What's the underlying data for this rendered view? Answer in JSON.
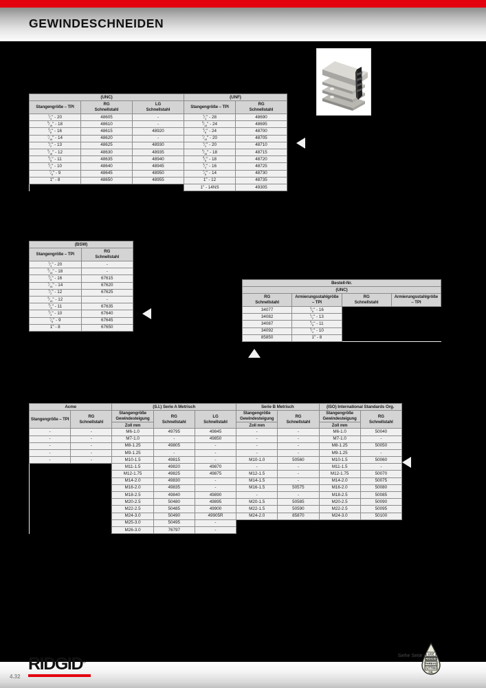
{
  "header": {
    "title": "GEWINDESCHNEIDEN",
    "accent_color": "#e3000f"
  },
  "product_image": {
    "alt": "Gewindeschneidbacken Stapel"
  },
  "tables": {
    "unc_unf": {
      "groups": [
        "(UNC)",
        "(UNF)"
      ],
      "columns": [
        "Stangengröße – TPI",
        "RG\nSchnellstahl",
        "LG\nSchnellstahl",
        "Stangengröße – TPI",
        "RG\nSchnellstahl"
      ],
      "rows": [
        [
          "1/4\" - 20",
          "48605",
          "-",
          "1/4\" - 28",
          "48690"
        ],
        [
          "5/16\" - 18",
          "48610",
          "-",
          "5/16\" - 24",
          "48695"
        ],
        [
          "3/8\" - 16",
          "48615",
          "48920",
          "3/8\" - 24",
          "48700"
        ],
        [
          "7/16\" - 14",
          "48620",
          "-",
          "7/16\" - 20",
          "48705"
        ],
        [
          "1/2\" - 13",
          "48625",
          "48930",
          "1/2\" - 20",
          "48710"
        ],
        [
          "9/16\" - 12",
          "48630",
          "48935",
          "9/16\" - 18",
          "48715"
        ],
        [
          "5/8\" - 11",
          "48635",
          "48940",
          "5/8\" - 18",
          "48720"
        ],
        [
          "3/4\" - 10",
          "48640",
          "48945",
          "3/4\" - 16",
          "48725"
        ],
        [
          "7/8\" - 9",
          "48645",
          "48950",
          "7/8\" - 14",
          "48730"
        ],
        [
          "1\" - 8",
          "48650",
          "48955",
          "1\" - 12",
          "48735"
        ],
        [
          "",
          "",
          "",
          "1\" - 14NS",
          "49305"
        ]
      ]
    },
    "bsw": {
      "group": "(BSW)",
      "columns": [
        "Stangengröße – TPI",
        "RG\nSchnellstahl"
      ],
      "rows": [
        [
          "1/4\" - 20",
          "-"
        ],
        [
          "5/16\" - 18",
          "-"
        ],
        [
          "3/8\" - 16",
          "67615"
        ],
        [
          "7/16\" - 14",
          "67620"
        ],
        [
          "1/2\" - 12",
          "67625"
        ],
        [
          "9/16\" - 12",
          "-"
        ],
        [
          "5/8\" - 11",
          "67635"
        ],
        [
          "3/4\" - 10",
          "67640"
        ],
        [
          "7/8\" - 9",
          "67645"
        ],
        [
          "1\" - 8",
          "67650"
        ]
      ]
    },
    "bestell": {
      "title": "Bestell-Nr.",
      "group": "(UNC)",
      "columns": [
        "RG\nSchnellstahl",
        "Armierungsstahlgröße\n– TPI",
        "RG\nSchnellstahl",
        "Armierungsstahlgröße\n– TPI"
      ],
      "rows": [
        [
          "34077",
          "3/8\" - 16",
          "",
          ""
        ],
        [
          "34082",
          "1/2\" - 13",
          "",
          ""
        ],
        [
          "34087",
          "5/8\" - 11",
          "",
          ""
        ],
        [
          "34092",
          "3/4\" - 10",
          "",
          ""
        ],
        [
          "85850",
          "1\" - 8",
          "",
          ""
        ]
      ]
    },
    "metric": {
      "groups": [
        "Acme",
        "(S.I.) Serie A Metrisch",
        "Serie B Metrisch",
        "(ISO) International Standards Org."
      ],
      "columns": [
        "Stangengröße – TPI",
        "RG\nSchnellstahl",
        "Stangengröße\nGewindesteigung\nZoll mm",
        "RG\nSchnellstahl",
        "LG\nSchnellstahl",
        "Stangengröße\nGewindesteigung\nZoll mm",
        "RG\nSchnellstahl",
        "Stangengröße\nGewindesteigung\nZoll mm",
        "RG\nSchnellstahl"
      ],
      "rows": [
        [
          "-",
          "-",
          "M6-1.0",
          "49795",
          "49845",
          "-",
          "-",
          "M6-1.0",
          "50040"
        ],
        [
          "-",
          "-",
          "M7-1.0",
          "-",
          "49850",
          "-",
          "-",
          "M7-1.0",
          "-"
        ],
        [
          "-",
          "-",
          "M8-1.25",
          "49805",
          "-",
          "-",
          "-",
          "M8-1.25",
          "50050"
        ],
        [
          "-",
          "-",
          "M9-1.25",
          "-",
          "-",
          "-",
          "-",
          "M9-1.25",
          "-"
        ],
        [
          "-",
          "-",
          "M10-1.5",
          "49815",
          "-",
          "M10-1.0",
          "50560",
          "M10-1.5",
          "50060"
        ],
        [
          "",
          "",
          "M11-1.5",
          "49820",
          "49870",
          "-",
          "-",
          "M11-1.5",
          "-"
        ],
        [
          "",
          "",
          "M12-1.75",
          "49825",
          "49875",
          "M12-1.5",
          "-",
          "M12-1.75",
          "50070"
        ],
        [
          "",
          "",
          "M14-2.0",
          "49830",
          "-",
          "M14-1.5",
          "-",
          "M14-2.0",
          "50075"
        ],
        [
          "",
          "",
          "M16-2.0",
          "49835",
          "-",
          "M16-1.5",
          "50575",
          "M16-2.0",
          "50080"
        ],
        [
          "",
          "",
          "M18-2.5",
          "49840",
          "49890",
          "-",
          "-",
          "M18-2.5",
          "50085"
        ],
        [
          "",
          "",
          "M20-2.5",
          "50480",
          "49895",
          "M20-1.5",
          "50585",
          "M20-2.5",
          "50090"
        ],
        [
          "",
          "",
          "M22-2.5",
          "50485",
          "49900",
          "M22-1.5",
          "50590",
          "M22-2.5",
          "50095"
        ],
        [
          "",
          "",
          "M24-3.0",
          "50490",
          "49905R",
          "M24-2.0",
          "85870",
          "M24-3.0",
          "50100"
        ],
        [
          "",
          "",
          "M25-3.0",
          "50495",
          "-",
          "",
          "",
          "",
          ""
        ],
        [
          "",
          "",
          "M26-3.0",
          "76797",
          "-",
          "",
          "",
          "",
          ""
        ]
      ]
    }
  },
  "arrows": {
    "unc": "arrow-left",
    "bsw": "arrow-left",
    "bestell": "arrow-up",
    "metric": "arrow-left"
  },
  "footer": {
    "page_number": "4.32",
    "brand": "RIDGID",
    "brand_mark": "®",
    "see_page_note": "Siehe Seite 4.12",
    "oil_drop": {
      "line1": "USE",
      "line2": "RIDGID",
      "line3": "THREAD",
      "line4": "CUTTING",
      "line5": "OIL"
    }
  }
}
